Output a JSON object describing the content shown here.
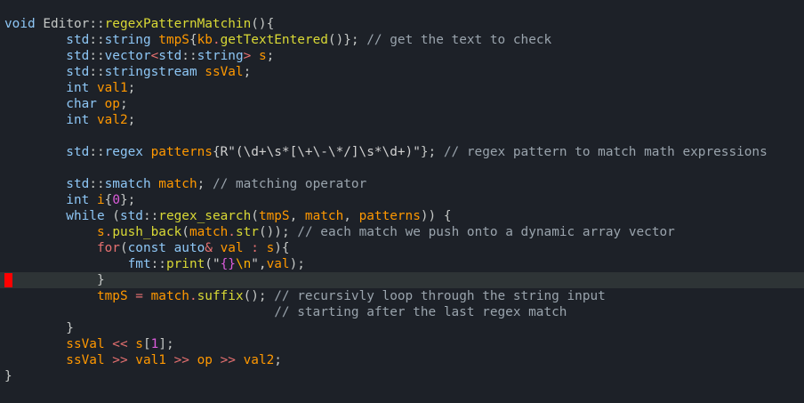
{
  "editor": {
    "theme": {
      "background": "#1d2128",
      "cursorline": "#2e3436",
      "marker": "#ff0000",
      "palette": {
        "default": "#c5c8c6",
        "keyword": "#8ec7f6",
        "type": "#8ec7f6",
        "ident": "#ff9800",
        "func": "#d9d935",
        "number": "#dc5cdc",
        "string": "#d0d0d0",
        "op": "#e87171",
        "comment": "#9aa4ad",
        "punct": "#c5c8c6",
        "scope": "#c5c8c6",
        "escape": "#ffb000"
      }
    },
    "cursor_line": 16,
    "lines": [
      [
        [
          "void ",
          "keyword"
        ],
        [
          "Editor",
          "default"
        ],
        [
          "::",
          "scope"
        ],
        [
          "regexPatternMatchin",
          "func"
        ],
        [
          "(){",
          "punct"
        ]
      ],
      [
        [
          "        std",
          "type"
        ],
        [
          "::",
          "scope"
        ],
        [
          "string ",
          "type"
        ],
        [
          "tmpS",
          "ident"
        ],
        [
          "{",
          "punct"
        ],
        [
          "kb",
          "ident"
        ],
        [
          ".",
          "op"
        ],
        [
          "getTextEntered",
          "func"
        ],
        [
          "()}; ",
          "punct"
        ],
        [
          "// get the text to check",
          "comment"
        ]
      ],
      [
        [
          "        std",
          "type"
        ],
        [
          "::",
          "scope"
        ],
        [
          "vector",
          "type"
        ],
        [
          "<",
          "op"
        ],
        [
          "std",
          "type"
        ],
        [
          "::",
          "scope"
        ],
        [
          "string",
          "type"
        ],
        [
          "> ",
          "op"
        ],
        [
          "s",
          "ident"
        ],
        [
          ";",
          "punct"
        ]
      ],
      [
        [
          "        std",
          "type"
        ],
        [
          "::",
          "scope"
        ],
        [
          "stringstream ",
          "type"
        ],
        [
          "ssVal",
          "ident"
        ],
        [
          ";",
          "punct"
        ]
      ],
      [
        [
          "        int ",
          "keyword"
        ],
        [
          "val1",
          "ident"
        ],
        [
          ";",
          "punct"
        ]
      ],
      [
        [
          "        char ",
          "keyword"
        ],
        [
          "op",
          "ident"
        ],
        [
          ";",
          "punct"
        ]
      ],
      [
        [
          "        int ",
          "keyword"
        ],
        [
          "val2",
          "ident"
        ],
        [
          ";",
          "punct"
        ]
      ],
      [
        [
          "",
          "default"
        ]
      ],
      [
        [
          "        std",
          "type"
        ],
        [
          "::",
          "scope"
        ],
        [
          "regex ",
          "type"
        ],
        [
          "patterns",
          "ident"
        ],
        [
          "{",
          "punct"
        ],
        [
          "R\"(\\d+\\s*[\\+\\-\\*/]\\s*\\d+)\"",
          "string"
        ],
        [
          "}; ",
          "punct"
        ],
        [
          "// regex pattern to match math expressions",
          "comment"
        ]
      ],
      [
        [
          "",
          "default"
        ]
      ],
      [
        [
          "        std",
          "type"
        ],
        [
          "::",
          "scope"
        ],
        [
          "smatch ",
          "type"
        ],
        [
          "match",
          "ident"
        ],
        [
          "; ",
          "punct"
        ],
        [
          "// matching operator",
          "comment"
        ]
      ],
      [
        [
          "        int ",
          "keyword"
        ],
        [
          "i",
          "ident"
        ],
        [
          "{",
          "punct"
        ],
        [
          "0",
          "number"
        ],
        [
          "};",
          "punct"
        ]
      ],
      [
        [
          "        while ",
          "keyword"
        ],
        [
          "(",
          "punct"
        ],
        [
          "std",
          "type"
        ],
        [
          "::",
          "scope"
        ],
        [
          "regex_search",
          "func"
        ],
        [
          "(",
          "punct"
        ],
        [
          "tmpS",
          "ident"
        ],
        [
          ", ",
          "punct"
        ],
        [
          "match",
          "ident"
        ],
        [
          ", ",
          "punct"
        ],
        [
          "patterns",
          "ident"
        ],
        [
          ")) {",
          "punct"
        ]
      ],
      [
        [
          "            s",
          "ident"
        ],
        [
          ".",
          "op"
        ],
        [
          "push_back",
          "func"
        ],
        [
          "(",
          "punct"
        ],
        [
          "match",
          "ident"
        ],
        [
          ".",
          "op"
        ],
        [
          "str",
          "func"
        ],
        [
          "()); ",
          "punct"
        ],
        [
          "// each match we push onto a dynamic array vector",
          "comment"
        ]
      ],
      [
        [
          "            for",
          "op"
        ],
        [
          "(",
          "punct"
        ],
        [
          "const ",
          "keyword"
        ],
        [
          "auto",
          "keyword"
        ],
        [
          "& ",
          "op"
        ],
        [
          "val ",
          "ident"
        ],
        [
          ": ",
          "op"
        ],
        [
          "s",
          "ident"
        ],
        [
          "){",
          "punct"
        ]
      ],
      [
        [
          "                fmt",
          "type"
        ],
        [
          "::",
          "scope"
        ],
        [
          "print",
          "func"
        ],
        [
          "(\"",
          "string"
        ],
        [
          "{}",
          "number"
        ],
        [
          "\\n",
          "escape"
        ],
        [
          "\",",
          "string"
        ],
        [
          "val",
          "ident"
        ],
        [
          ");",
          "punct"
        ]
      ],
      [
        [
          "            }",
          "punct"
        ]
      ],
      [
        [
          "            tmpS ",
          "ident"
        ],
        [
          "= ",
          "op"
        ],
        [
          "match",
          "ident"
        ],
        [
          ".",
          "op"
        ],
        [
          "suffix",
          "func"
        ],
        [
          "(); ",
          "punct"
        ],
        [
          "// recursivly loop through the string input",
          "comment"
        ]
      ],
      [
        [
          "                                   // starting after the last regex match",
          "comment"
        ]
      ],
      [
        [
          "        }",
          "punct"
        ]
      ],
      [
        [
          "        ssVal ",
          "ident"
        ],
        [
          "<< ",
          "op"
        ],
        [
          "s",
          "ident"
        ],
        [
          "[",
          "punct"
        ],
        [
          "1",
          "number"
        ],
        [
          "];",
          "punct"
        ]
      ],
      [
        [
          "        ssVal ",
          "ident"
        ],
        [
          ">> ",
          "op"
        ],
        [
          "val1 ",
          "ident"
        ],
        [
          ">> ",
          "op"
        ],
        [
          "op ",
          "ident"
        ],
        [
          ">> ",
          "op"
        ],
        [
          "val2",
          "ident"
        ],
        [
          ";",
          "punct"
        ]
      ],
      [
        [
          "}",
          "punct"
        ]
      ]
    ]
  }
}
